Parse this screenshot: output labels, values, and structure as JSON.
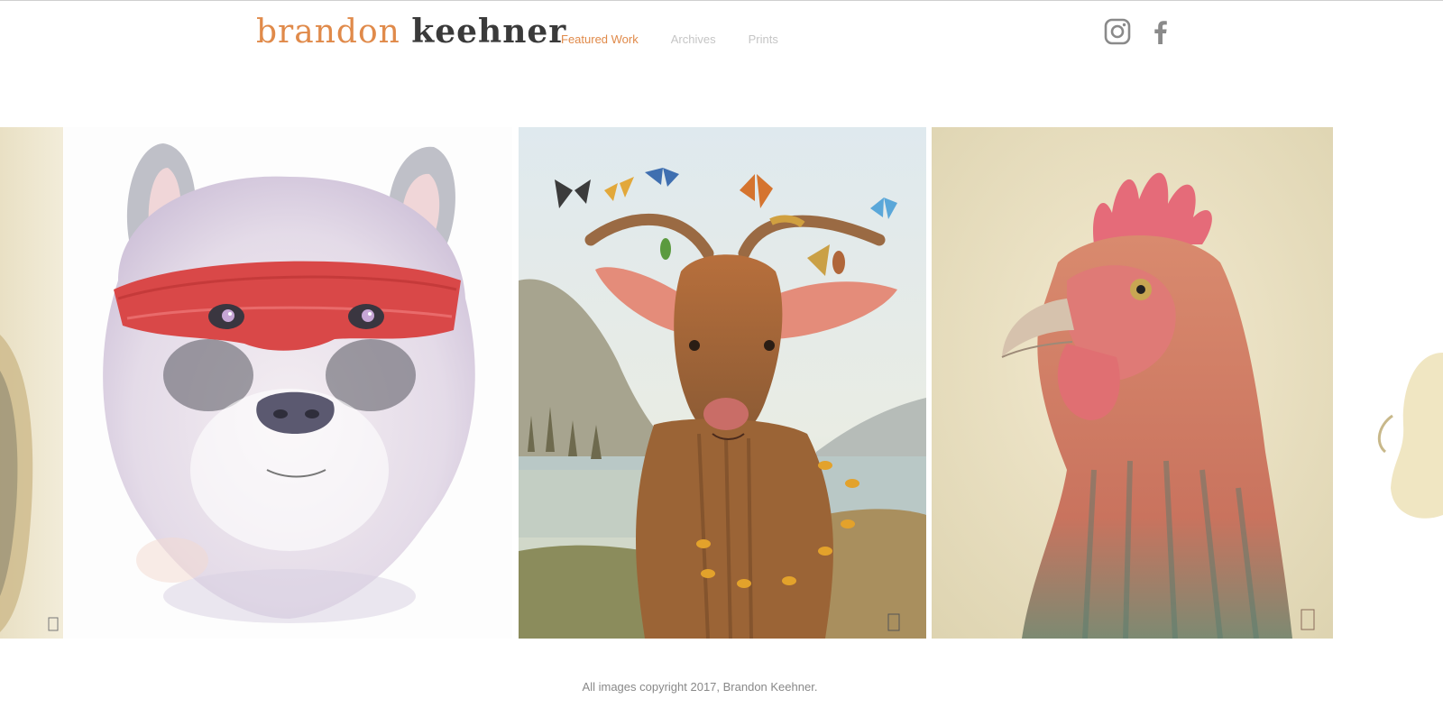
{
  "header": {
    "logo_first": "brandon",
    "logo_last": "keehner",
    "nav": [
      {
        "label": "Featured Work",
        "active": true
      },
      {
        "label": "Archives",
        "active": false
      },
      {
        "label": "Prints",
        "active": false
      }
    ],
    "social": [
      "instagram-icon",
      "facebook-icon"
    ]
  },
  "gallery": {
    "artworks": [
      {
        "subject": "partial painting left edge"
      },
      {
        "subject": "masked bear watercolor"
      },
      {
        "subject": "goat with butterflies and bees"
      },
      {
        "subject": "rooster portrait"
      },
      {
        "subject": "partial painting right edge"
      }
    ]
  },
  "footer": {
    "copyright": "All images copyright 2017, Brandon Keehner."
  },
  "colors": {
    "accent": "#e08a4a",
    "nav_inactive": "#c5c5c5",
    "text_dark": "#3a3a3a"
  }
}
